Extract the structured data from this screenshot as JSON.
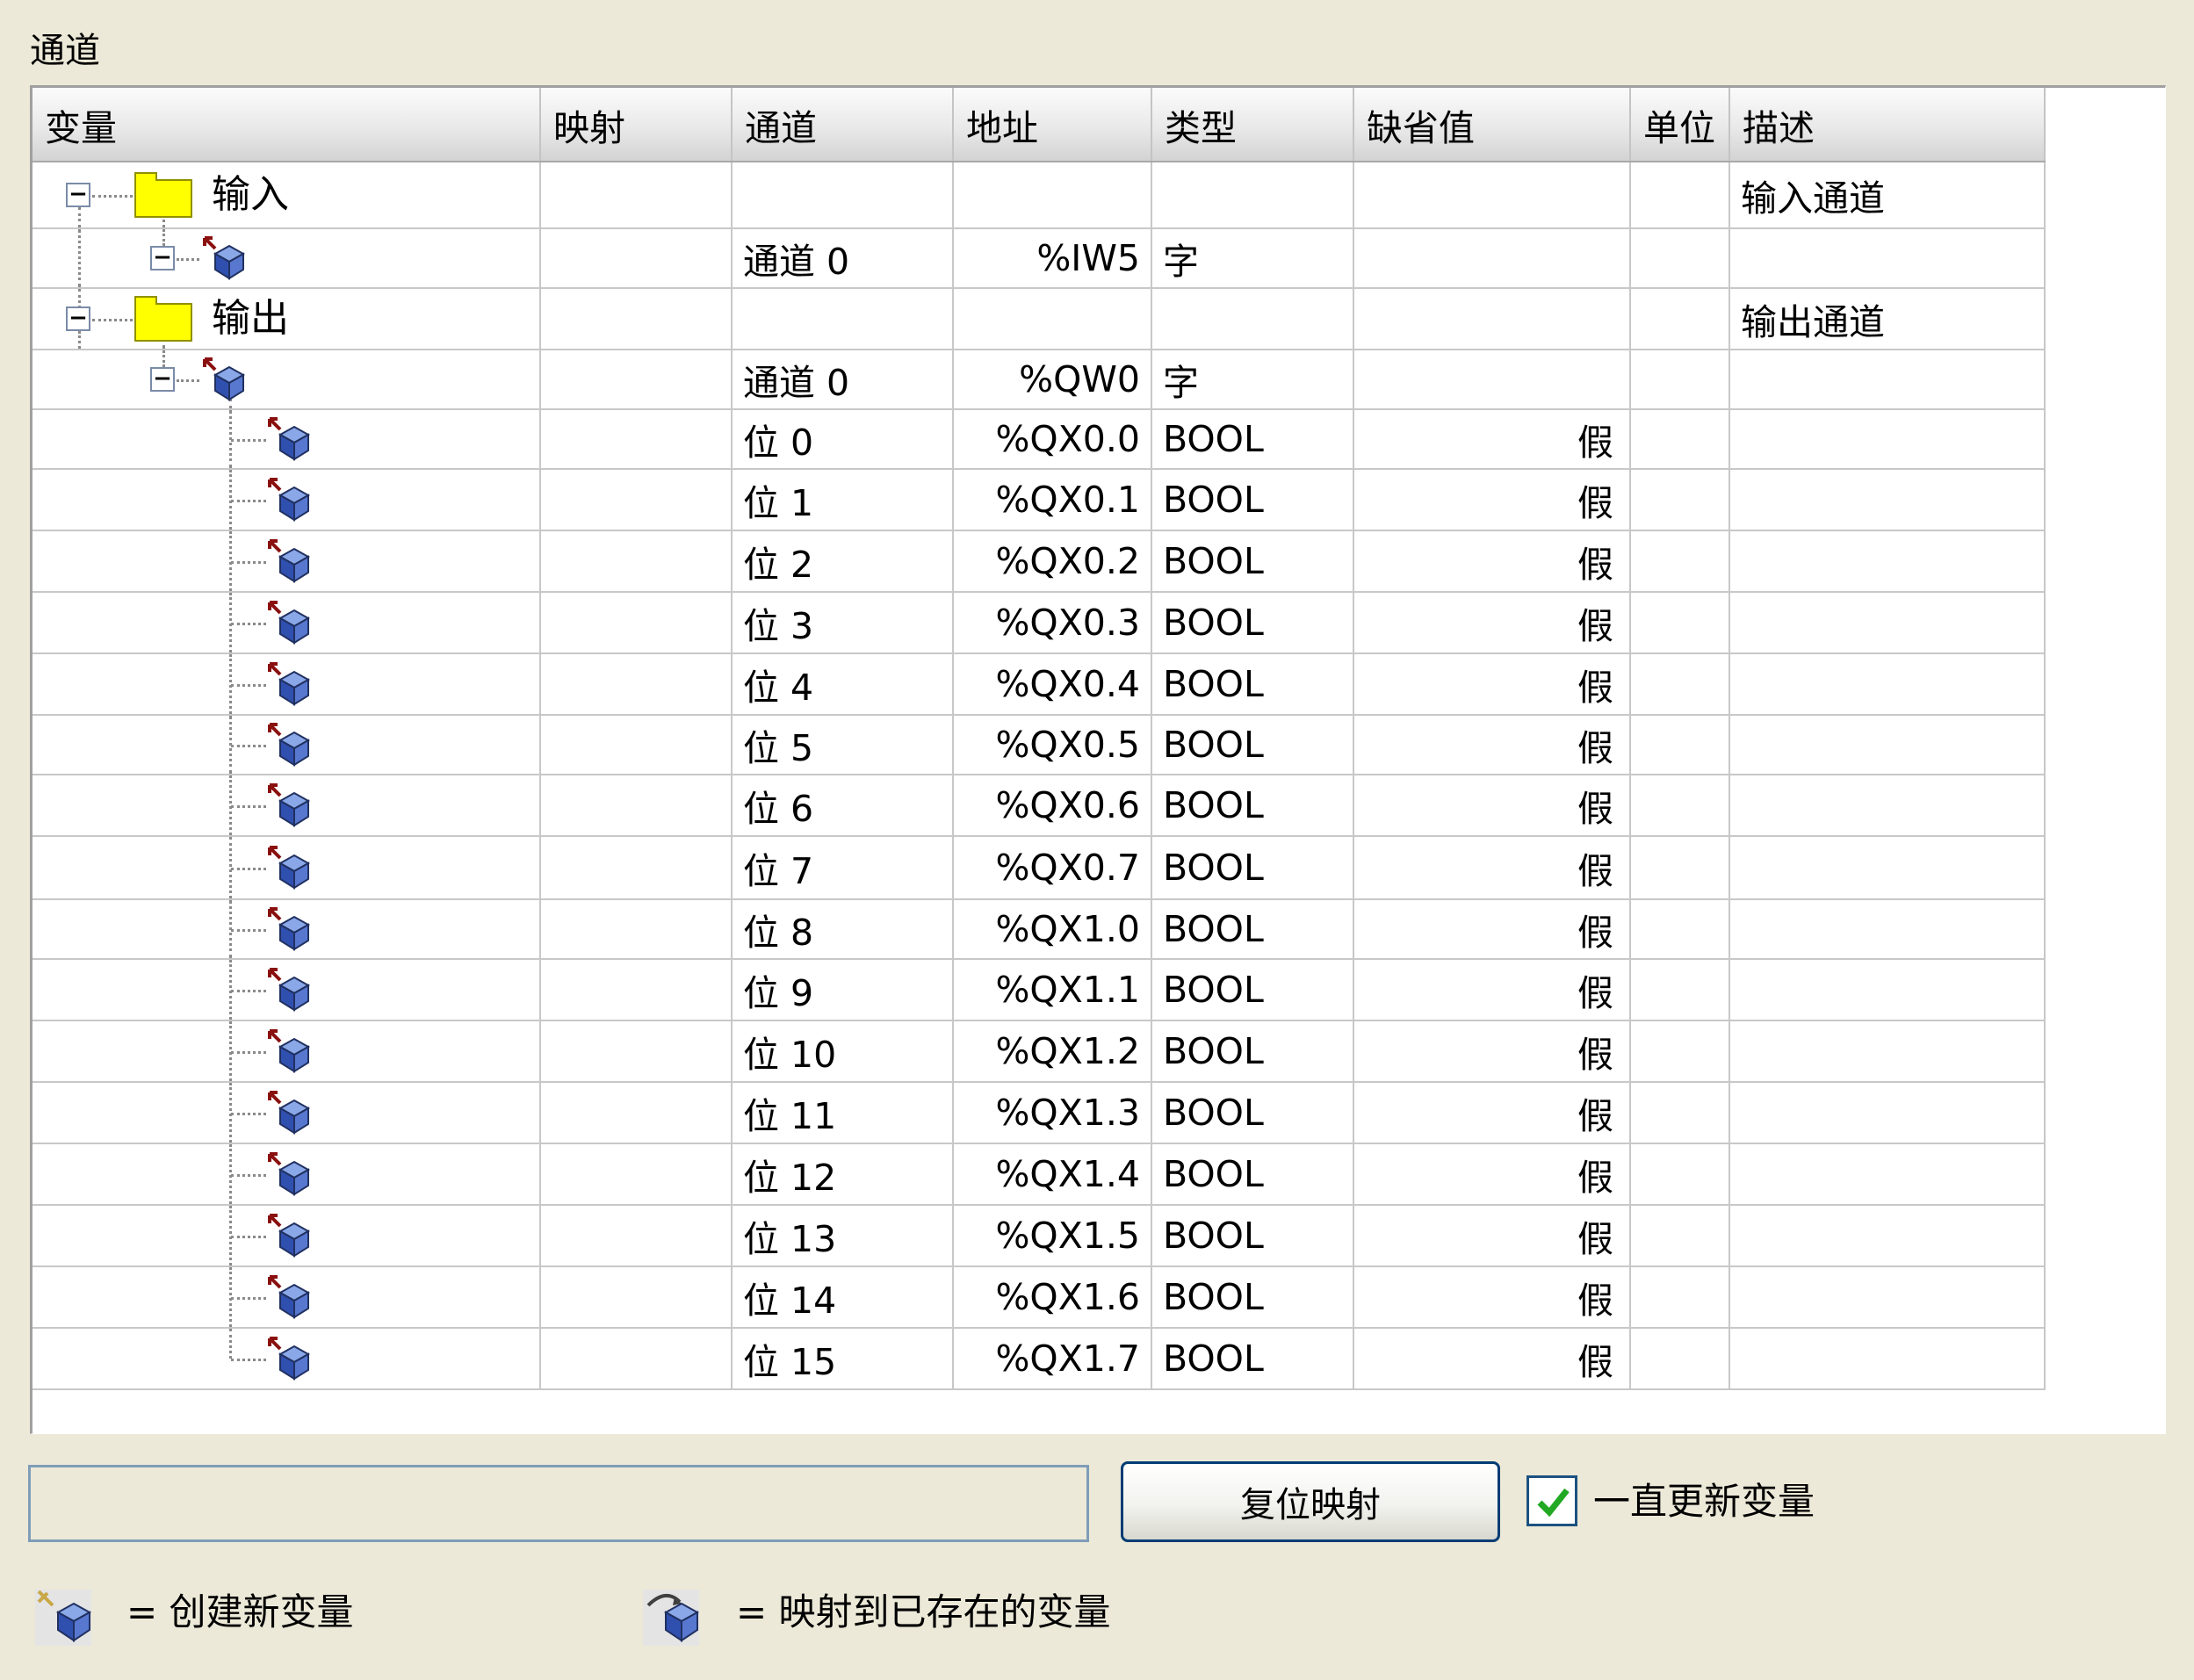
{
  "panel": {
    "title": "通道"
  },
  "table": {
    "columns": [
      {
        "key": "variable",
        "label": "变量"
      },
      {
        "key": "mapping",
        "label": "映射"
      },
      {
        "key": "channel",
        "label": "通道"
      },
      {
        "key": "address",
        "label": "地址"
      },
      {
        "key": "type",
        "label": "类型"
      },
      {
        "key": "default",
        "label": "缺省值"
      },
      {
        "key": "unit",
        "label": "单位"
      },
      {
        "key": "description",
        "label": "描述"
      }
    ],
    "rows": [
      {
        "kind": "folder",
        "level": 0,
        "label": "输入",
        "channel": "",
        "address": "",
        "type": "",
        "default": "",
        "unit": "",
        "description": "输入通道"
      },
      {
        "kind": "channel",
        "level": 1,
        "label": "",
        "channel": "通道 0",
        "address": "%IW5",
        "type": "字",
        "default": "",
        "unit": "",
        "description": ""
      },
      {
        "kind": "folder",
        "level": 0,
        "label": "输出",
        "channel": "",
        "address": "",
        "type": "",
        "default": "",
        "unit": "",
        "description": "输出通道"
      },
      {
        "kind": "channel",
        "level": 1,
        "label": "",
        "channel": "通道 0",
        "address": "%QW0",
        "type": "字",
        "default": "",
        "unit": "",
        "description": ""
      },
      {
        "kind": "bit",
        "level": 2,
        "label": "",
        "channel": "位 0",
        "address": "%QX0.0",
        "type": "BOOL",
        "default": "假",
        "unit": "",
        "description": ""
      },
      {
        "kind": "bit",
        "level": 2,
        "label": "",
        "channel": "位 1",
        "address": "%QX0.1",
        "type": "BOOL",
        "default": "假",
        "unit": "",
        "description": ""
      },
      {
        "kind": "bit",
        "level": 2,
        "label": "",
        "channel": "位 2",
        "address": "%QX0.2",
        "type": "BOOL",
        "default": "假",
        "unit": "",
        "description": ""
      },
      {
        "kind": "bit",
        "level": 2,
        "label": "",
        "channel": "位 3",
        "address": "%QX0.3",
        "type": "BOOL",
        "default": "假",
        "unit": "",
        "description": ""
      },
      {
        "kind": "bit",
        "level": 2,
        "label": "",
        "channel": "位 4",
        "address": "%QX0.4",
        "type": "BOOL",
        "default": "假",
        "unit": "",
        "description": ""
      },
      {
        "kind": "bit",
        "level": 2,
        "label": "",
        "channel": "位 5",
        "address": "%QX0.5",
        "type": "BOOL",
        "default": "假",
        "unit": "",
        "description": ""
      },
      {
        "kind": "bit",
        "level": 2,
        "label": "",
        "channel": "位 6",
        "address": "%QX0.6",
        "type": "BOOL",
        "default": "假",
        "unit": "",
        "description": ""
      },
      {
        "kind": "bit",
        "level": 2,
        "label": "",
        "channel": "位 7",
        "address": "%QX0.7",
        "type": "BOOL",
        "default": "假",
        "unit": "",
        "description": ""
      },
      {
        "kind": "bit",
        "level": 2,
        "label": "",
        "channel": "位 8",
        "address": "%QX1.0",
        "type": "BOOL",
        "default": "假",
        "unit": "",
        "description": ""
      },
      {
        "kind": "bit",
        "level": 2,
        "label": "",
        "channel": "位 9",
        "address": "%QX1.1",
        "type": "BOOL",
        "default": "假",
        "unit": "",
        "description": ""
      },
      {
        "kind": "bit",
        "level": 2,
        "label": "",
        "channel": "位 10",
        "address": "%QX1.2",
        "type": "BOOL",
        "default": "假",
        "unit": "",
        "description": ""
      },
      {
        "kind": "bit",
        "level": 2,
        "label": "",
        "channel": "位 11",
        "address": "%QX1.3",
        "type": "BOOL",
        "default": "假",
        "unit": "",
        "description": ""
      },
      {
        "kind": "bit",
        "level": 2,
        "label": "",
        "channel": "位 12",
        "address": "%QX1.4",
        "type": "BOOL",
        "default": "假",
        "unit": "",
        "description": ""
      },
      {
        "kind": "bit",
        "level": 2,
        "label": "",
        "channel": "位 13",
        "address": "%QX1.5",
        "type": "BOOL",
        "default": "假",
        "unit": "",
        "description": ""
      },
      {
        "kind": "bit",
        "level": 2,
        "label": "",
        "channel": "位 14",
        "address": "%QX1.6",
        "type": "BOOL",
        "default": "假",
        "unit": "",
        "description": ""
      },
      {
        "kind": "bit",
        "level": 2,
        "label": "",
        "channel": "位 15",
        "address": "%QX1.7",
        "type": "BOOL",
        "default": "假",
        "unit": "",
        "description": ""
      }
    ]
  },
  "controls": {
    "status_text": "",
    "reset_button_label": "复位映射",
    "always_update_checked": true,
    "always_update_label": "一直更新变量"
  },
  "legend": {
    "create_new_icon": "new-variable-icon",
    "create_new_text": "= 创建新变量",
    "map_existing_icon": "map-existing-variable-icon",
    "map_existing_text": "= 映射到已存在的变量"
  },
  "colors": {
    "background": "#ece9d8",
    "folder": "#ffff00",
    "button_border": "#003c74",
    "checkbox_border": "#1c5180",
    "check_mark": "#22a822"
  }
}
